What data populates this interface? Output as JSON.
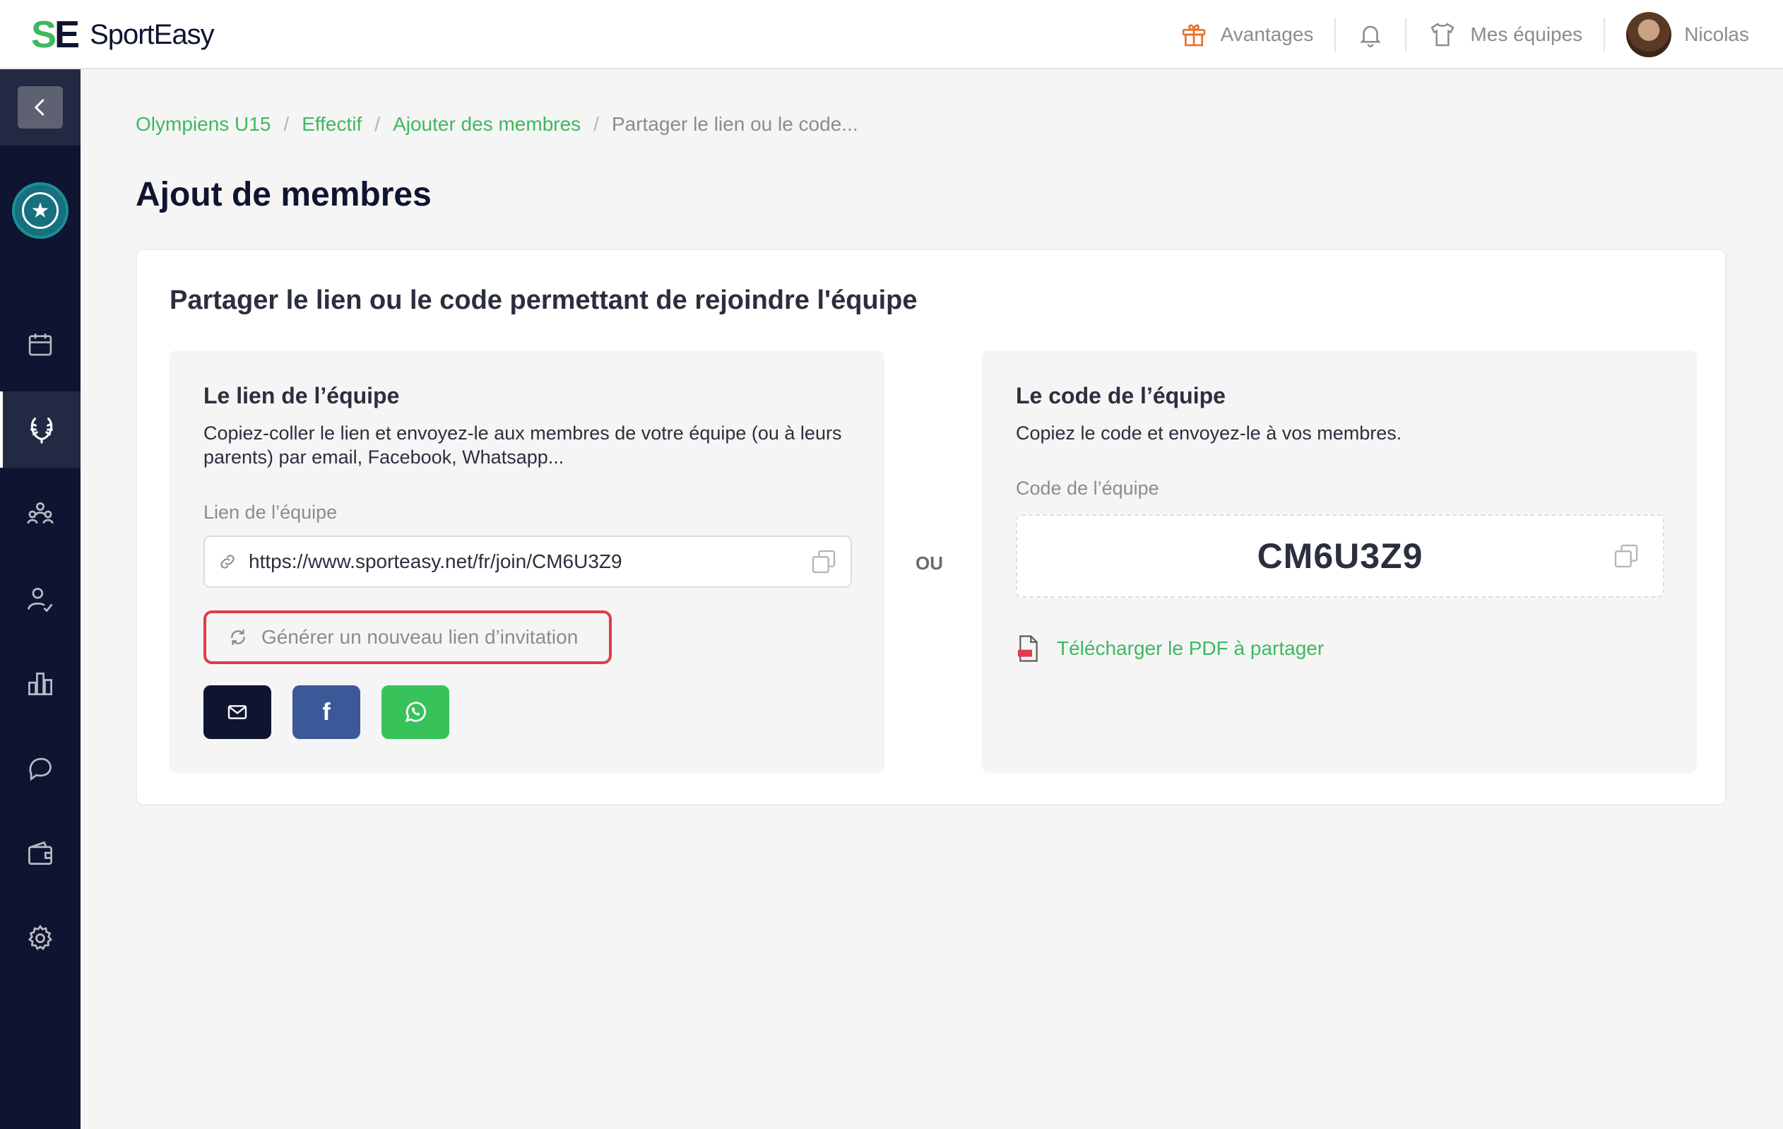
{
  "app": {
    "logo_mark_s": "S",
    "logo_mark_e": "E",
    "logo_text": "SportEasy"
  },
  "topbar": {
    "advantages": "Avantages",
    "teams": "Mes équipes",
    "user_name": "Nicolas"
  },
  "breadcrumb": [
    "Olympiens U15",
    "Effectif",
    "Ajouter des membres",
    "Partager le lien ou le code..."
  ],
  "page_title": "Ajout de membres",
  "card_title": "Partager le lien ou le code permettant de rejoindre l'équipe",
  "link_panel": {
    "heading": "Le lien de l’équipe",
    "description": "Copiez-coller le lien et envoyez-le aux membres de votre équipe (ou à leurs parents) par email, Facebook, Whatsapp...",
    "field_label": "Lien de l’équipe",
    "link_value": "https://www.sporteasy.net/fr/join/CM6U3Z9",
    "regen_label": "Générer un nouveau lien d’invitation",
    "share_buttons": [
      "mail",
      "facebook",
      "whatsapp"
    ],
    "facebook_glyph": "f"
  },
  "separator": "OU",
  "code_panel": {
    "heading": "Le code de l’équipe",
    "description": "Copiez le code et envoyez-le à vos membres.",
    "field_label": "Code de l’équipe",
    "code_value": "CM6U3Z9",
    "pdf_label": "Télécharger le PDF à partager"
  },
  "colors": {
    "brand_green": "#3fb85f",
    "navy": "#0f1430",
    "facebook": "#3b5998",
    "whatsapp": "#37c35a",
    "highlight_red": "#e23b4a"
  }
}
